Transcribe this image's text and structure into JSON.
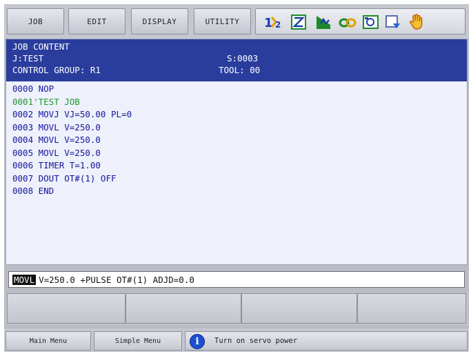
{
  "menu": {
    "job": "JOB",
    "edit": "EDIT",
    "display": "DISPLAY",
    "utility": "UTILITY"
  },
  "status_icons": [
    "coordinate-digits-icon",
    "edit-mode-icon",
    "cycle-mode-icon",
    "teach-lock-icon",
    "monitor-icon",
    "play-step-icon",
    "hand-icon"
  ],
  "job_content": {
    "title": "JOB CONTENT",
    "job_name": "J:TEST",
    "step": "S:0003",
    "control_group": "CONTROL GROUP: R1",
    "tool": "TOOL: 00",
    "lines": [
      "0000 NOP",
      "0001'TEST JOB",
      "0002 MOVJ VJ=50.00 PL=0",
      "0003 MOVL V=250.0",
      "0004 MOVL V=250.0",
      "0005 MOVL V=250.0",
      "0006 TIMER T=1.00",
      "0007 DOUT OT#(1) OFF",
      "0008 END"
    ]
  },
  "edit_buffer": {
    "command": "MOVL",
    "params": "V=250.0 +PULSE OT#(1) ADJD=0.0"
  },
  "bottom": {
    "main_menu": "Main Menu",
    "simple_menu": "Simple Menu",
    "message": "Turn on servo power"
  },
  "colors": {
    "header_bg": "#2a3d9d",
    "content_bg": "#eef0fb",
    "text": "#15169a",
    "comment": "#1f9a2e",
    "panel": "#b9bcc4"
  }
}
